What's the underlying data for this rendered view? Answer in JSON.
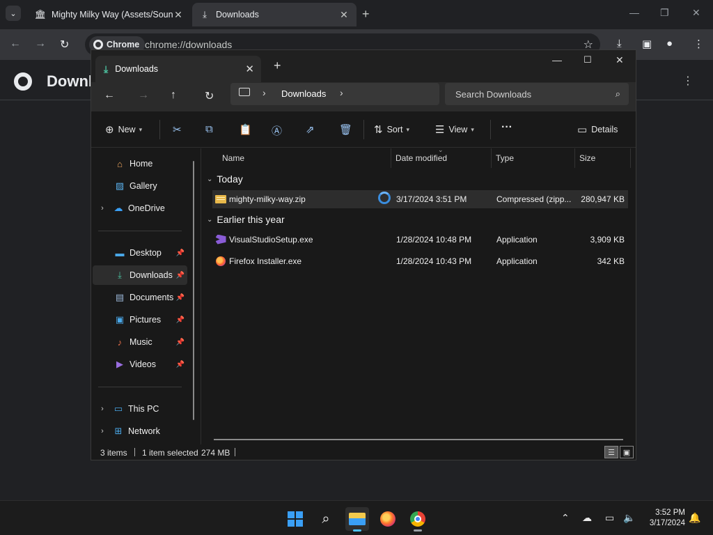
{
  "chrome": {
    "tabs": [
      {
        "title": "Mighty Milky Way (Assets/Sound",
        "icon": "museum-icon"
      },
      {
        "title": "Downloads",
        "icon": "download-icon"
      }
    ],
    "chip_label": "Chrome",
    "url": "chrome://downloads",
    "page_title": "Downloads"
  },
  "explorer": {
    "tab_title": "Downloads",
    "breadcrumb": "Downloads",
    "search_placeholder": "Search Downloads",
    "commands": {
      "new": "New",
      "sort": "Sort",
      "view": "View",
      "more": "···",
      "details": "Details"
    },
    "sidebar": {
      "top": [
        {
          "label": "Home",
          "icon": "home-icon",
          "expandable": false
        },
        {
          "label": "Gallery",
          "icon": "gallery-icon",
          "expandable": false
        },
        {
          "label": "OneDrive",
          "icon": "cloud-icon",
          "expandable": true
        }
      ],
      "pinned": [
        {
          "label": "Desktop",
          "icon": "desktop-icon",
          "selected": false
        },
        {
          "label": "Downloads",
          "icon": "download-icon",
          "selected": true
        },
        {
          "label": "Documents",
          "icon": "documents-icon",
          "selected": false
        },
        {
          "label": "Pictures",
          "icon": "pictures-icon",
          "selected": false
        },
        {
          "label": "Music",
          "icon": "music-icon",
          "selected": false
        },
        {
          "label": "Videos",
          "icon": "videos-icon",
          "selected": false
        }
      ],
      "bottom": [
        {
          "label": "This PC",
          "icon": "computer-icon"
        },
        {
          "label": "Network",
          "icon": "network-icon"
        }
      ]
    },
    "columns": [
      "Name",
      "Date modified",
      "Type",
      "Size"
    ],
    "groups": [
      {
        "label": "Today",
        "files": [
          {
            "name": "mighty-milky-way.zip",
            "date": "3/17/2024 3:51 PM",
            "type": "Compressed (zipp...",
            "size": "280,947 KB",
            "icon": "zip-icon",
            "selected": true
          }
        ]
      },
      {
        "label": "Earlier this year",
        "files": [
          {
            "name": "VisualStudioSetup.exe",
            "date": "1/28/2024 10:48 PM",
            "type": "Application",
            "size": "3,909 KB",
            "icon": "visual-studio-icon",
            "selected": false
          },
          {
            "name": "Firefox Installer.exe",
            "date": "1/28/2024 10:43 PM",
            "type": "Application",
            "size": "342 KB",
            "icon": "firefox-icon",
            "selected": false
          }
        ]
      }
    ],
    "status": {
      "items": "3 items",
      "selection": "1 item selected",
      "size": "274 MB"
    }
  },
  "taskbar": {
    "time": "3:52 PM",
    "date": "3/17/2024"
  }
}
